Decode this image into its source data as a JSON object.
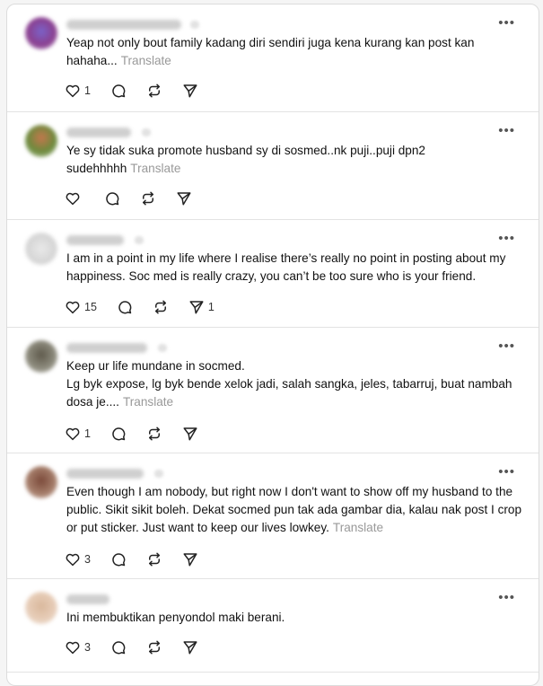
{
  "colors": {
    "background": "#ffffff",
    "text": "#111111",
    "muted": "#999999",
    "border": "#e3e3e3"
  },
  "translate_label": "Translate",
  "posts": [
    {
      "text": "Yeap not only bout family kadang diri sendiri juga kena kurang kan post kan hahaha...",
      "show_translate": true,
      "likes": "1",
      "reposts": "",
      "shares": ""
    },
    {
      "text": "Ye sy tidak suka promote husband sy di sosmed..nk puji..puji dpn2 sudehhhhh",
      "show_translate": true,
      "likes": "",
      "reposts": "",
      "shares": ""
    },
    {
      "text": "I am in a point in my life where I realise there’s really no point in posting about my happiness. Soc med is really crazy, you can’t be too sure who is your friend.",
      "show_translate": false,
      "likes": "15",
      "reposts": "",
      "shares": "1"
    },
    {
      "text": "Keep ur life mundane in socmed.\nLg byk expose, lg byk bende xelok jadi, salah sangka, jeles, tabarruj, buat nambah dosa je....",
      "show_translate": true,
      "likes": "1",
      "reposts": "",
      "shares": ""
    },
    {
      "text": "Even though I am nobody, but right now I don't want to show off my husband to the public. Sikit sikit boleh. Dekat socmed pun tak ada gambar dia, kalau nak post I crop or put sticker. Just want to keep our lives lowkey.",
      "show_translate": true,
      "likes": "3",
      "reposts": "",
      "shares": ""
    },
    {
      "text": "Ini membuktikan penyondol maki berani.",
      "show_translate": false,
      "likes": "3",
      "reposts": "",
      "shares": ""
    }
  ]
}
